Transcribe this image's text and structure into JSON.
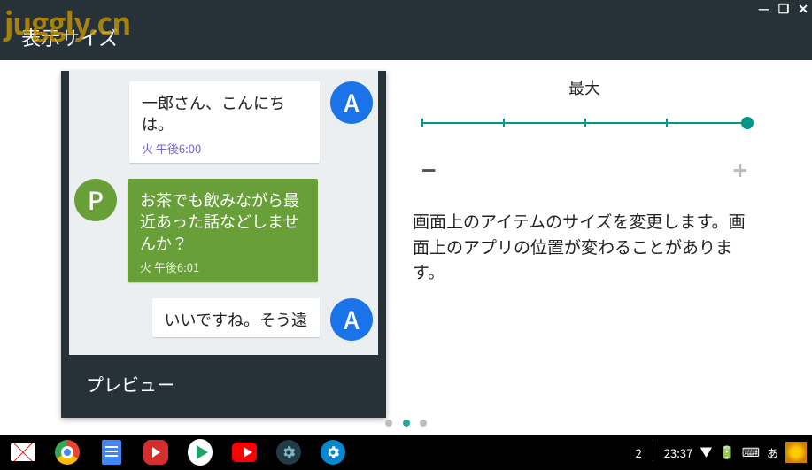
{
  "watermark": "juggly.cn",
  "window_controls": {
    "minimize": "—",
    "restore": "❐",
    "close": "✕"
  },
  "header": {
    "title": "表示サイズ"
  },
  "preview": {
    "label": "プレビュー",
    "messages": [
      {
        "side": "right",
        "avatar": "A",
        "text": "一郎さん、こんにちは。",
        "ts": "火 午後6:00"
      },
      {
        "side": "left",
        "avatar": "P",
        "text": "お茶でも飲みながら最近あった話などしませんか？",
        "ts": "火 午後6:01"
      },
      {
        "side": "right",
        "avatar": "A",
        "text": "いいですね。そう遠",
        "ts": ""
      }
    ]
  },
  "settings": {
    "slider_label": "最大",
    "minus": "−",
    "plus": "+",
    "description": "画面上のアイテムのサイズを変更します。画面上のアプリの位置が変わることがあります。"
  },
  "taskbar": {
    "notif_count": "2",
    "time": "23:37",
    "ime": "あ"
  }
}
